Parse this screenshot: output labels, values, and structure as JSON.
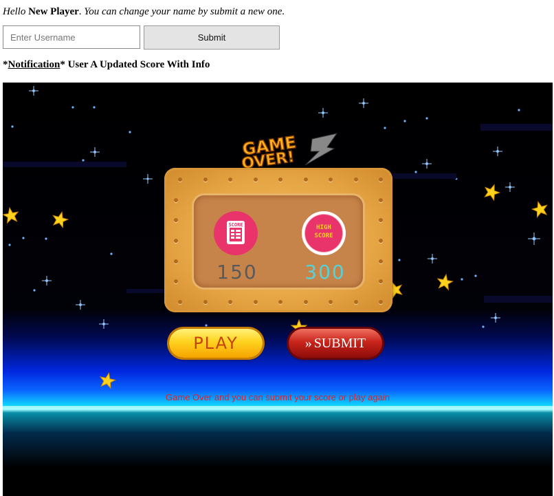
{
  "greeting": {
    "hello": "Hello",
    "player_name": "New Player",
    "period": ".",
    "instruction": "You can change your name by submit a new one."
  },
  "form": {
    "username_placeholder": "Enter Username",
    "submit_label": "Submit"
  },
  "notification": {
    "prefix": "*",
    "label": "Notification",
    "suffix": "*",
    "text": "User A Updated Score With Info"
  },
  "game": {
    "title": "GAME OVER!",
    "score_icon_label": "SCORE",
    "highscore_icon_label": "HIGH SCORE",
    "score": "150",
    "high_score": "300",
    "play_label": "PLAY",
    "submit_label": "SUBMIT",
    "message": "Game Over and you can submit your score or play again",
    "colors": {
      "score_text": "#5a5a5a",
      "high_score_text": "#56d1d8",
      "message": "#e0202a",
      "badge": "#e8336b"
    }
  }
}
